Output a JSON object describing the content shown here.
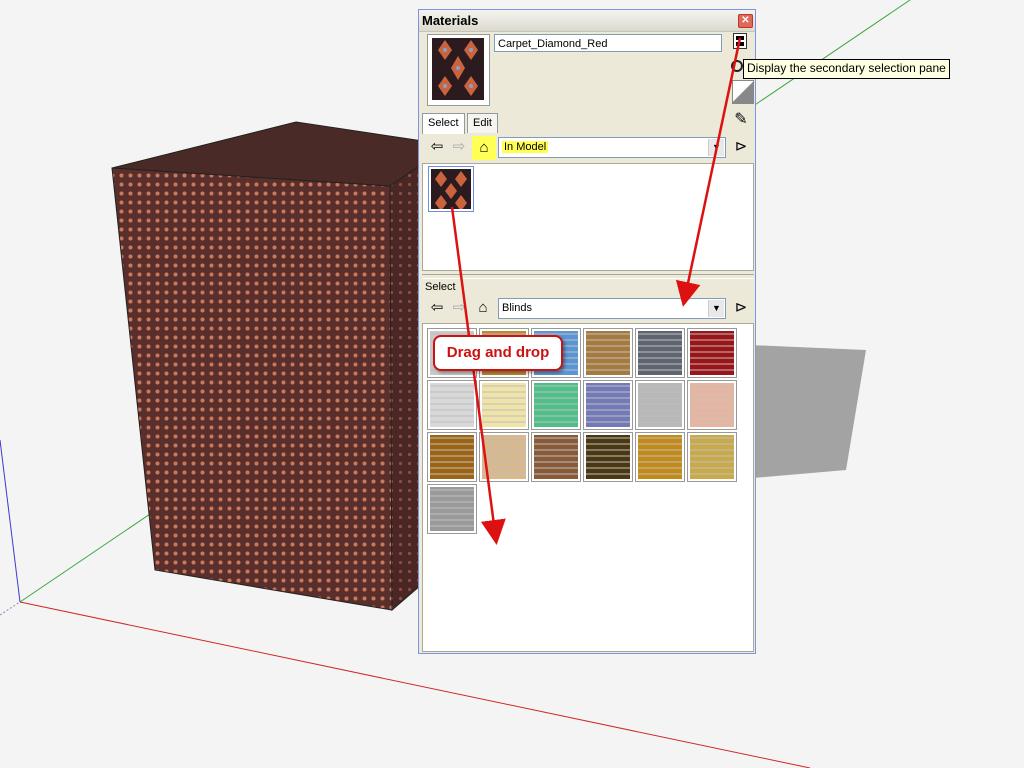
{
  "panel": {
    "title": "Materials",
    "current_material": "Carpet_Diamond_Red",
    "tabs": [
      {
        "label": "Select"
      },
      {
        "label": "Edit"
      }
    ],
    "primary_collection": "In Model",
    "secondary_label": "Select",
    "secondary_collection": "Blinds",
    "blinds": [
      {
        "name": "blind-white",
        "color": "#c9c9c9"
      },
      {
        "name": "blind-tan",
        "color": "#b88a3a"
      },
      {
        "name": "blind-blue",
        "color": "#5a95d6"
      },
      {
        "name": "blind-brown-stripe",
        "color": "#a57a3f"
      },
      {
        "name": "blind-gray",
        "color": "#5e6470"
      },
      {
        "name": "blind-red",
        "color": "#9a1418"
      },
      {
        "name": "blind-light-gray",
        "color": "#d8d8d8"
      },
      {
        "name": "blind-cream",
        "color": "#efe3a8"
      },
      {
        "name": "blind-green",
        "color": "#4fbf8a"
      },
      {
        "name": "blind-purple",
        "color": "#7479b8"
      },
      {
        "name": "blind-silver",
        "color": "#b8b8b8"
      },
      {
        "name": "blind-pink",
        "color": "#e8b5a0"
      },
      {
        "name": "blind-amber",
        "color": "#9c6414"
      },
      {
        "name": "blind-lattice",
        "color": "#d9b98c"
      },
      {
        "name": "blind-wood",
        "color": "#8a5a38"
      },
      {
        "name": "blind-dark-brown",
        "color": "#4a3812"
      },
      {
        "name": "blind-gold",
        "color": "#c38a1a"
      },
      {
        "name": "blind-khaki",
        "color": "#c9aa4a"
      },
      {
        "name": "blind-metal",
        "color": "#9a9a9a"
      }
    ]
  },
  "tooltip": "Display the secondary selection pane",
  "callout": "Drag and drop",
  "colors": {
    "accent_red": "#cc1111",
    "highlight": "#ffff55",
    "box_face": "#6a3b36",
    "box_top": "#4a2a26"
  }
}
